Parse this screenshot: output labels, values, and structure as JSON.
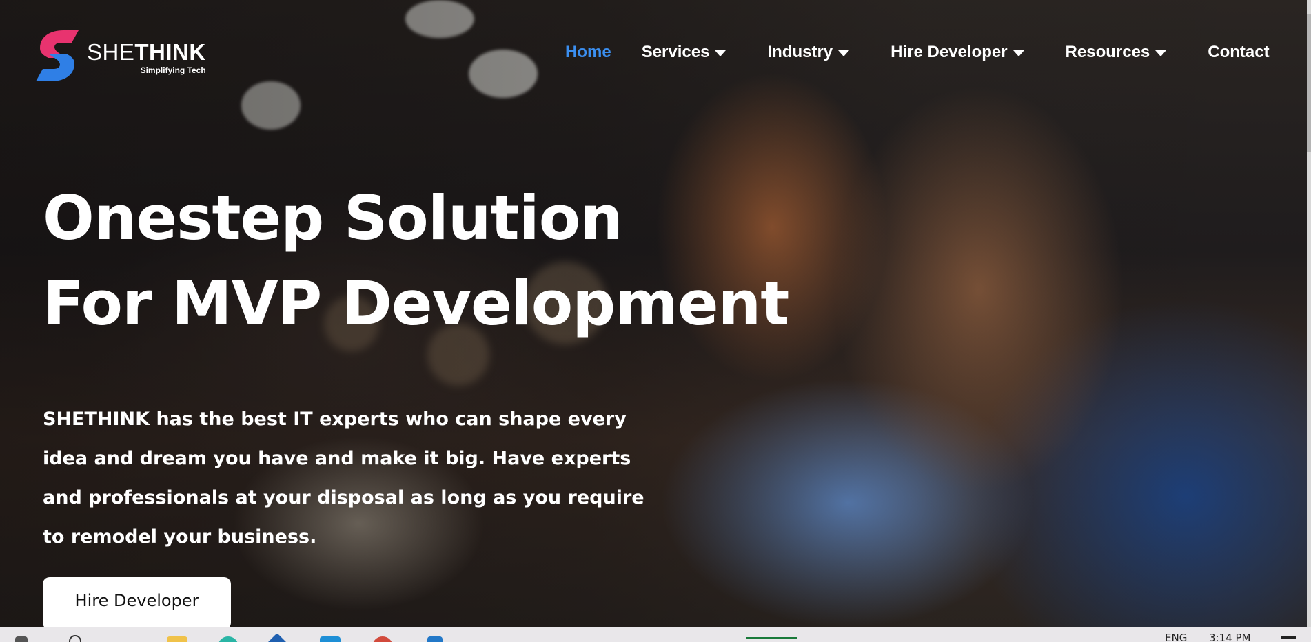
{
  "brand": {
    "name_light": "SHE",
    "name_bold": "THINK",
    "tagline": "Simplifying Tech",
    "colors": {
      "pink": "#e8336f",
      "blue": "#2f7fe6"
    }
  },
  "nav": {
    "items": [
      {
        "label": "Home",
        "active": true,
        "dropdown": false
      },
      {
        "label": "Services",
        "active": false,
        "dropdown": true
      },
      {
        "label": "Industry",
        "active": false,
        "dropdown": true
      },
      {
        "label": "Hire Developer",
        "active": false,
        "dropdown": true
      },
      {
        "label": "Resources",
        "active": false,
        "dropdown": true
      },
      {
        "label": "Contact",
        "active": false,
        "dropdown": false
      }
    ],
    "active_color": "#3b8ff0"
  },
  "hero": {
    "title_line1": "Onestep Solution",
    "title_line2": "For MVP Development",
    "description": "SHETHINK has the best IT experts who can shape every idea and dream you have and make it big. Have experts and professionals at your disposal as long as you require to remodel your business.",
    "cta_label": "Hire Developer"
  },
  "taskbar": {
    "language": "ENG",
    "time": "3:14 PM"
  }
}
